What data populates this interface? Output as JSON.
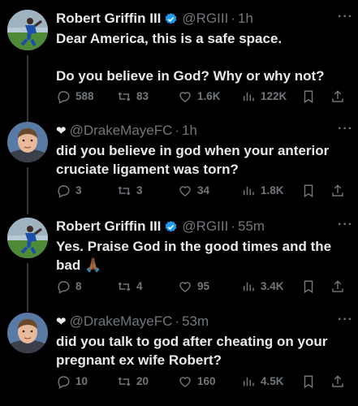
{
  "tweets": [
    {
      "name": "Robert Griffin III",
      "handle": "@RGIII",
      "time": "1h",
      "text": "Dear America, this is a safe space.\n\nDo you believe in God? Why or why not?",
      "replies": "588",
      "retweets": "83",
      "likes": "1.6K",
      "views": "122K",
      "more_icon": "···"
    },
    {
      "prefix_icon": "❤",
      "name": "",
      "handle": "@DrakeMayeFC",
      "time": "1h",
      "text": "did you believe in god when your anterior cruciate ligament was torn?",
      "replies": "3",
      "retweets": "3",
      "likes": "34",
      "views": "1.8K",
      "more_icon": "···"
    },
    {
      "name": "Robert Griffin III",
      "handle": "@RGIII",
      "time": "55m",
      "text": "Yes. Praise God in the good times and the bad 🙏🏾",
      "replies": "8",
      "retweets": "4",
      "likes": "95",
      "views": "3.4K",
      "more_icon": "···"
    },
    {
      "prefix_icon": "❤",
      "name": "",
      "handle": "@DrakeMayeFC",
      "time": "53m",
      "text": "did you talk to god after cheating on your pregnant ex wife Robert?",
      "replies": "10",
      "retweets": "20",
      "likes": "160",
      "views": "4.5K",
      "more_icon": "···"
    }
  ],
  "separator": "·",
  "colors": {
    "background": "#000000",
    "text": "#e7e9ea",
    "muted": "#71767b",
    "verified": "#1d9bf0"
  }
}
